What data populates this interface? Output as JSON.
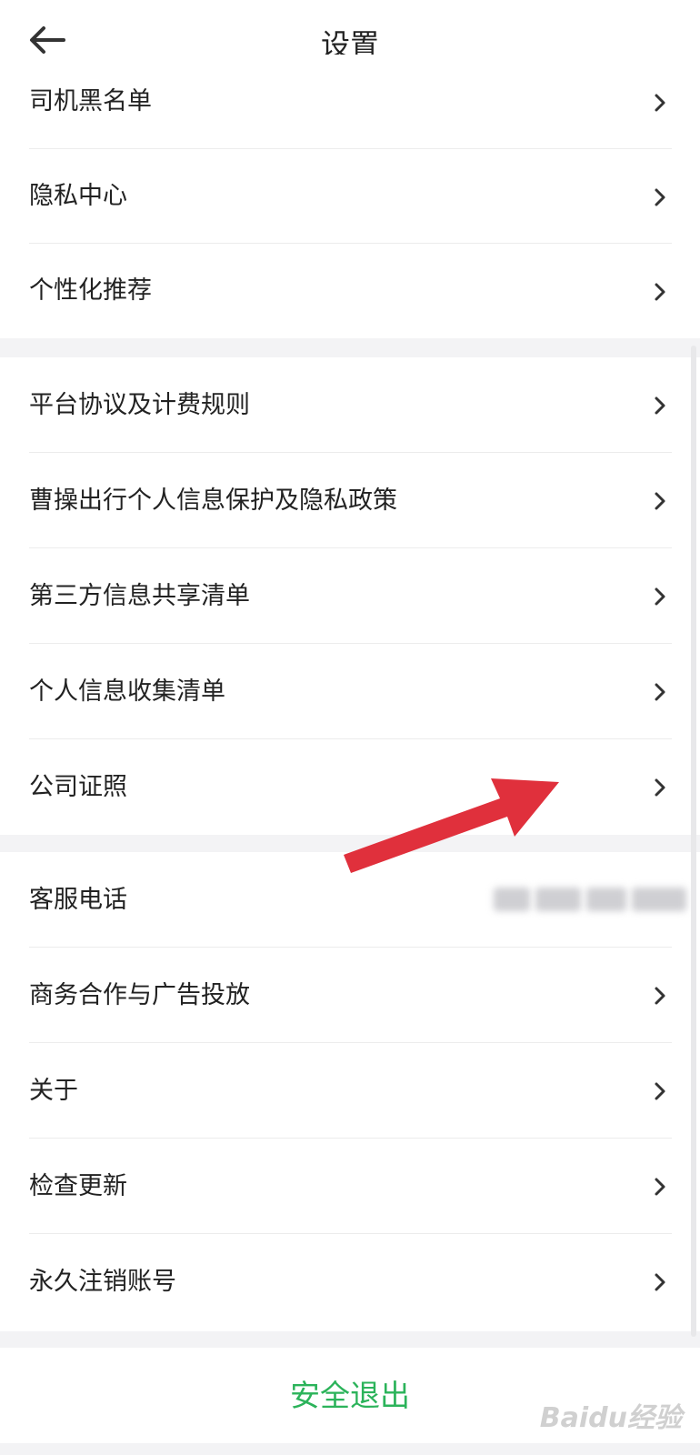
{
  "header": {
    "title": "设置"
  },
  "groups": [
    {
      "items": [
        {
          "label": "司机黑名单"
        },
        {
          "label": "隐私中心"
        },
        {
          "label": "个性化推荐"
        }
      ]
    },
    {
      "items": [
        {
          "label": "平台协议及计费规则"
        },
        {
          "label": "曹操出行个人信息保护及隐私政策"
        },
        {
          "label": "第三方信息共享清单"
        },
        {
          "label": "个人信息收集清单"
        },
        {
          "label": "公司证照"
        }
      ]
    },
    {
      "items": [
        {
          "label": "客服电话"
        },
        {
          "label": "商务合作与广告投放"
        },
        {
          "label": "关于"
        },
        {
          "label": "检查更新"
        },
        {
          "label": "永久注销账号"
        }
      ]
    }
  ],
  "logout": {
    "label": "安全退出"
  },
  "colors": {
    "accent": "#2bb35a",
    "annotation_arrow": "#e0303c"
  },
  "watermark": "Baidu经验"
}
